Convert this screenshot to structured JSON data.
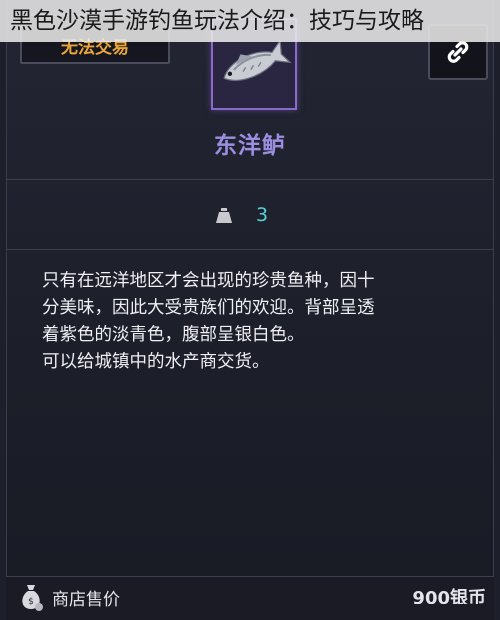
{
  "caption": "黑色沙漠手游钓鱼玩法介绍：技巧与攻略",
  "item": {
    "trade_status": "无法交易",
    "name": "东洋鲈",
    "weight": "3",
    "description": [
      "只有在远洋地区才会出现的珍贵鱼种，因十",
      "分美味，因此大受贵族们的欢迎。背部呈透",
      "着紫色的淡青色，腹部呈银白色。",
      "可以给城镇中的水产商交货。"
    ]
  },
  "footer": {
    "shop_price_label": "商店售价",
    "shop_price_value": "900银币"
  },
  "icons": {
    "link": "link-icon",
    "weight": "weight-icon",
    "money_bag": "money-bag-icon",
    "fish": "fish-icon"
  },
  "colors": {
    "trade_status": "#e8a53a",
    "item_name": "#9b8ee0",
    "weight_value": "#52d4d6",
    "frame_border": "#8a6ac8"
  }
}
